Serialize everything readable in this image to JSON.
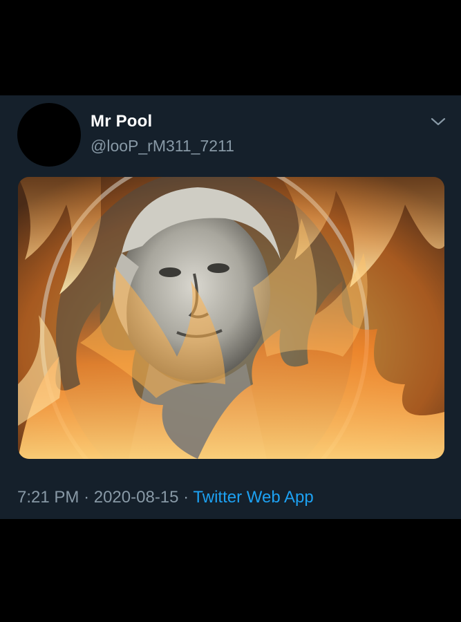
{
  "tweet": {
    "author": {
      "display_name": "Mr Pool",
      "handle": "@looP_rM311_7211"
    },
    "menu_icon": "chevron-down-icon",
    "media": {
      "description_icon": "burning-dollar-bill-image"
    },
    "time": "7:21 PM",
    "separator": "·",
    "date": "2020-08-15",
    "source": "Twitter Web App"
  },
  "colors": {
    "page_background": "#000000",
    "card_background": "#15202b",
    "text_primary": "#ffffff",
    "text_secondary": "#8899a6",
    "link": "#1da1f2"
  }
}
